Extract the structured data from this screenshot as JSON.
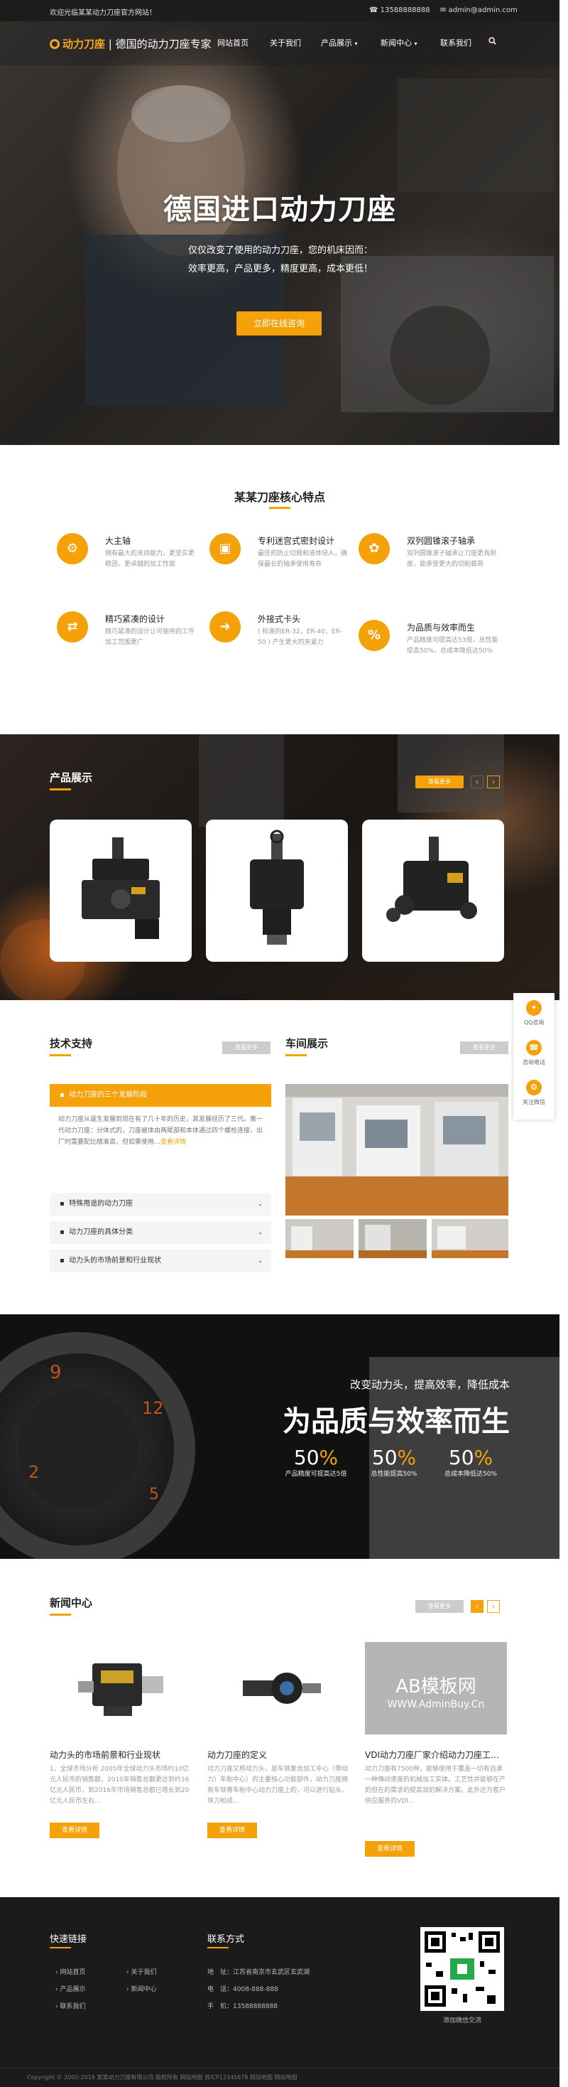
{
  "topbar": {
    "welcome": "欢迎光临某某动力刀座官方网站！",
    "phone": "13588888888",
    "email": "admin@admin.com"
  },
  "nav": {
    "logo_brand": "动力刀座",
    "logo_slogan": "德国的动力刀座专家",
    "items": [
      "网站首页",
      "关于我们",
      "产品展示",
      "新闻中心",
      "联系我们"
    ],
    "search_icon": "search-icon"
  },
  "hero": {
    "title": "德国进口动力刀座",
    "sub1": "仅仅改变了使用的动力刀座，您的机床因而：",
    "sub2": "效率更高，产品更多，精度更高，成本更低！",
    "button": "立即在线咨询"
  },
  "features": {
    "title": "某某刀座核心特点",
    "items": [
      {
        "icon": "spindle-icon",
        "title": "大主轴",
        "desc": "拥有最大的夹持能力，更坚实更稳固，更卓越的加工性能"
      },
      {
        "icon": "seal-icon",
        "title": "专利迷宫式密封设计",
        "desc": "最佳的防止切屑和液体侵入，确保最长的轴承使用寿命"
      },
      {
        "icon": "bearing-icon",
        "title": "双列圆锥滚子轴承",
        "desc": "双列圆锥滚子轴承让刀座更具刚度，能承受更大的切削载荷"
      },
      {
        "icon": "transmission-icon",
        "title": "精巧紧凑的设计",
        "desc": "精巧紧凑的设计让可使用的工件加工范围更广"
      },
      {
        "icon": "clamp-icon",
        "title": "外接式卡头",
        "desc": "( 标准的ER-32，ER-40，ER-50 ) 产生更大的夹紧力"
      },
      {
        "icon": "percent-icon",
        "title": "为品质与效率而生",
        "desc": "产品精度可提高达53倍，总性能提高50%，总成本降低达50%"
      }
    ]
  },
  "products": {
    "title": "产品展示",
    "more": "查看更多",
    "prev": "‹",
    "next": "›"
  },
  "support": {
    "title": "技术支持",
    "more": "查看更多",
    "active_q": "动力刀座的三个发展阶段",
    "active_a": "动力刀座从诞生发展到现在有了几十年的历史，其发展经历了三代。第一代动力刀座：分体式的，刀座被体由两尾部和本体通过四个螺栓连接，出厂时需要配比精准高，但如果使用…",
    "active_link": "查看详情",
    "rows": [
      "特殊用途的动力刀座",
      "动力刀座的具体分类",
      "动力头的市场前景和行业现状"
    ]
  },
  "workshop": {
    "title": "车间展示",
    "more": "查看更多"
  },
  "slogan": {
    "line1": "改变动力头，提高效率，降低成本",
    "line2": "为品质与效率而生",
    "stats": [
      {
        "num": "50",
        "unit": "%",
        "label": "产品精度可提高达5倍"
      },
      {
        "num": "50",
        "unit": "%",
        "label": "总性能提高50%"
      },
      {
        "num": "50",
        "unit": "%",
        "label": "总成本降低达50%"
      }
    ]
  },
  "news": {
    "title": "新闻中心",
    "more": "查看更多",
    "items": [
      {
        "title": "动力头的市场前景和行业现状",
        "desc": "1、全球市场分析 2005年全球动力头市场约10亿元人民币的销售额，2010年销售总额更达到约16亿元人民币，到2016年市场销售总额已增长到20亿元人民币左右…",
        "btn": "查看详情"
      },
      {
        "title": "动力刀座的定义",
        "desc": "动力刀座又称动力头，是车铣复合加工中心（带动力）车削中心）的主要核心功能部件，动力刀座拥有车铣等车削中心动力刀座上的，可以进行钻头、铣刀和成…",
        "btn": "查看详情"
      },
      {
        "title": "VDI动力刀座厂家介绍动力刀座工…",
        "desc": "动力刀座有7500种，能够使用于覆盖一切有自承一种傳动速度的机械加工实体。工艺性并能够在产的但在的需求的提高效的解决方案。此外还为客户供应服务的VDI…",
        "btn": "查看详情"
      }
    ]
  },
  "watermark": {
    "line1": "AB模板网",
    "line2": "WWW.AdminBuy.Cn"
  },
  "footer": {
    "links_title": "快速链接",
    "links": [
      "网站首页",
      "关于我们",
      "产品展示",
      "新闻中心",
      "联系我们"
    ],
    "contact_title": "联系方式",
    "address_label": "地　址：",
    "address": "江苏省南京市玄武区玄武湖",
    "phone_label": "电　话：",
    "phone": "4008-888-888",
    "mobile_label": "手　机：",
    "mobile": "13588888888",
    "qr_caption": "添加微信交流",
    "copyright": "Copyright © 2002-2019 某某动力刀座有限公司 版权所有  网站地图  苏ICP12345678  网站地图  网站地图"
  },
  "side": {
    "items": [
      "QQ咨询",
      "咨询电话",
      "关注微信"
    ]
  },
  "colors": {
    "accent": "#f5a10a",
    "dark": "#1b1b1b"
  }
}
